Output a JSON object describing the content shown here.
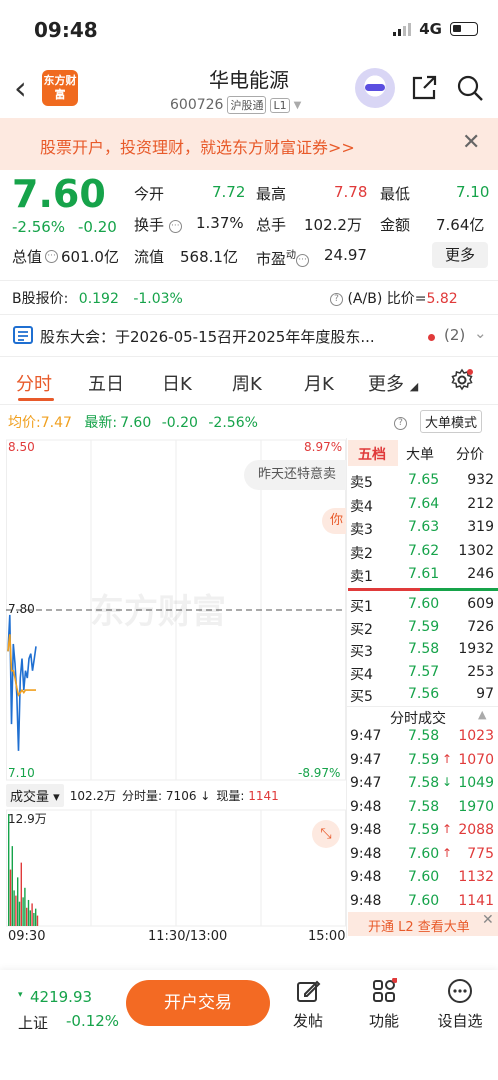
{
  "status_bar": {
    "time": "09:48",
    "network": "4G"
  },
  "header": {
    "logo_text": "东方财富",
    "stock_name": "华电能源",
    "stock_code": "600726",
    "tags": [
      "沪股通",
      "L1"
    ]
  },
  "banner": {
    "text": "股票开户，投资理财，就选东方财富证券>>"
  },
  "quote": {
    "price": "7.60",
    "pct": "-2.56%",
    "change": "-0.20",
    "market_cap_label": "总值",
    "market_cap": "601.0亿",
    "open_label": "今开",
    "open": "7.72",
    "high_label": "最高",
    "high": "7.78",
    "low_label": "最低",
    "low": "7.10",
    "turnover_label": "换手",
    "turnover": "1.37%",
    "volume_label": "总手",
    "volume": "102.2万",
    "amount_label": "金额",
    "amount": "7.64亿",
    "float_label": "流值",
    "float_cap": "568.1亿",
    "pe_label": "市盈",
    "pe_sup": "动",
    "pe": "24.97",
    "more_label": "更多"
  },
  "bshare": {
    "label": "B股报价:",
    "price": "0.192",
    "pct": "-1.03%",
    "ratio_label": "(A/B) 比价=",
    "ratio": "5.82"
  },
  "notice": {
    "text": "股东大会：于2026-05-15召开2025年年度股东...",
    "count": "(2)"
  },
  "tabs": [
    "分时",
    "五日",
    "日K",
    "周K",
    "月K",
    "更多"
  ],
  "chart_info": {
    "avg_label": "均价:",
    "avg": "7.47",
    "latest_label": "最新:",
    "latest": "7.60",
    "change": "-0.20",
    "pct": "-2.56%",
    "big_order_btn": "大单模式",
    "tooltip": "昨天还特意卖",
    "watermark": "东方财富",
    "side_tag": "你",
    "expand_icon": "expand-icon"
  },
  "chart_data": {
    "type": "line",
    "title": "",
    "ylim": [
      7.1,
      8.5
    ],
    "y_ticks_left": [
      "8.50",
      "7.80",
      "7.10"
    ],
    "y_ticks_right": [
      "8.97%",
      "-8.97%"
    ],
    "prev_close": 7.8,
    "x_ticks": [
      "09:30",
      "11:30/13:00",
      "15:00"
    ],
    "series": [
      {
        "values": [
          7.63,
          7.78,
          7.33,
          7.66,
          7.58,
          7.45,
          7.22,
          7.52,
          7.6,
          7.47,
          7.55,
          7.52,
          7.6,
          7.62,
          7.55,
          7.6,
          7.65
        ],
        "color": "#1f6fd1"
      },
      {
        "values": [
          7.63,
          7.7,
          7.55,
          7.55,
          7.52,
          7.48,
          7.45,
          7.46,
          7.47,
          7.46,
          7.47,
          7.47,
          7.47,
          7.47,
          7.47,
          7.47,
          7.47
        ],
        "color": "#f0a020"
      }
    ],
    "volume_ylabel": "12.9万",
    "volume_bars": [
      12.9,
      6.5,
      9.2,
      4.1,
      3.5,
      5.6,
      2.8,
      7.3,
      3.3,
      4.4,
      2.1,
      3.0,
      1.8,
      2.6,
      1.5,
      2.0,
      1.2
    ]
  },
  "volume_bar": {
    "select_label": "成交量",
    "total": "102.2万",
    "minute_label": "分时量:",
    "minute_vol": "7106",
    "current_label": "现量:",
    "current_vol": "1141"
  },
  "order_book": {
    "tabs": [
      "五档",
      "大单",
      "分价"
    ],
    "sells": [
      {
        "label": "卖5",
        "price": "7.65",
        "vol": "932"
      },
      {
        "label": "卖4",
        "price": "7.64",
        "vol": "212"
      },
      {
        "label": "卖3",
        "price": "7.63",
        "vol": "319"
      },
      {
        "label": "卖2",
        "price": "7.62",
        "vol": "1302"
      },
      {
        "label": "卖1",
        "price": "7.61",
        "vol": "246"
      }
    ],
    "buys": [
      {
        "label": "买1",
        "price": "7.60",
        "vol": "609"
      },
      {
        "label": "买2",
        "price": "7.59",
        "vol": "726"
      },
      {
        "label": "买3",
        "price": "7.58",
        "vol": "1932"
      },
      {
        "label": "买4",
        "price": "7.57",
        "vol": "253"
      },
      {
        "label": "买5",
        "price": "7.56",
        "vol": "97"
      }
    ],
    "trades_title": "分时成交",
    "trades": [
      {
        "time": "9:47",
        "price": "7.58",
        "arrow": "",
        "vol": "1023",
        "dir": "red"
      },
      {
        "time": "9:47",
        "price": "7.59",
        "arrow": "↑",
        "vol": "1070",
        "dir": "red"
      },
      {
        "time": "9:47",
        "price": "7.58",
        "arrow": "↓",
        "vol": "1049",
        "dir": "green"
      },
      {
        "time": "9:48",
        "price": "7.58",
        "arrow": "",
        "vol": "1970",
        "dir": "green"
      },
      {
        "time": "9:48",
        "price": "7.59",
        "arrow": "↑",
        "vol": "2088",
        "dir": "red"
      },
      {
        "time": "9:48",
        "price": "7.60",
        "arrow": "↑",
        "vol": "775",
        "dir": "red"
      },
      {
        "time": "9:48",
        "price": "7.60",
        "arrow": "",
        "vol": "1132",
        "dir": "red"
      },
      {
        "time": "9:48",
        "price": "7.60",
        "arrow": "",
        "vol": "1141",
        "dir": "red"
      }
    ],
    "l2_banner": "开通 L2 查看大单"
  },
  "bottom": {
    "index_value": "4219.93",
    "index_name": "上证",
    "index_pct": "-0.12%",
    "trade_btn": "开户交易",
    "nav": [
      "发帖",
      "功能",
      "设自选"
    ]
  }
}
